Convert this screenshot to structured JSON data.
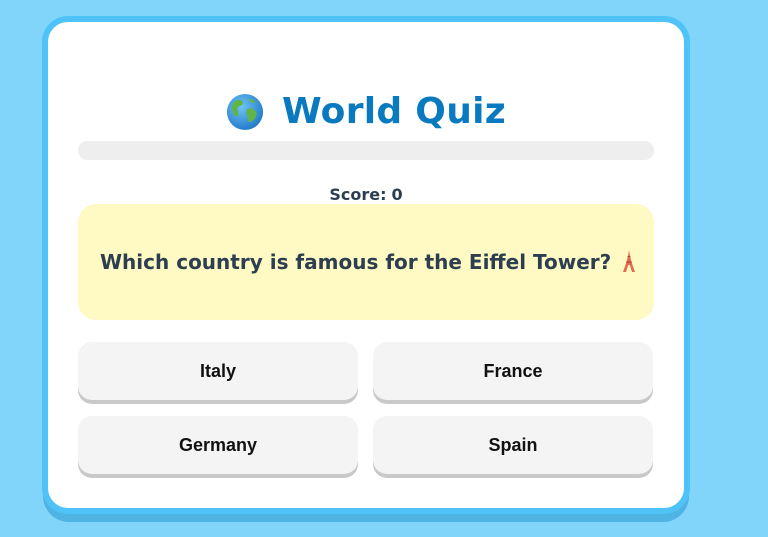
{
  "quiz": {
    "title": "World Quiz",
    "title_icon": "globe-icon",
    "accent_color": "#0a7ac0",
    "progress_fraction": 0,
    "score_label": "Score:",
    "score_value": "0",
    "question": {
      "text": "Which country is famous for the Eiffel Tower?",
      "icon": "eiffel-tower-icon"
    },
    "answers": [
      {
        "label": "Italy"
      },
      {
        "label": "France"
      },
      {
        "label": "Germany"
      },
      {
        "label": "Spain"
      }
    ]
  }
}
